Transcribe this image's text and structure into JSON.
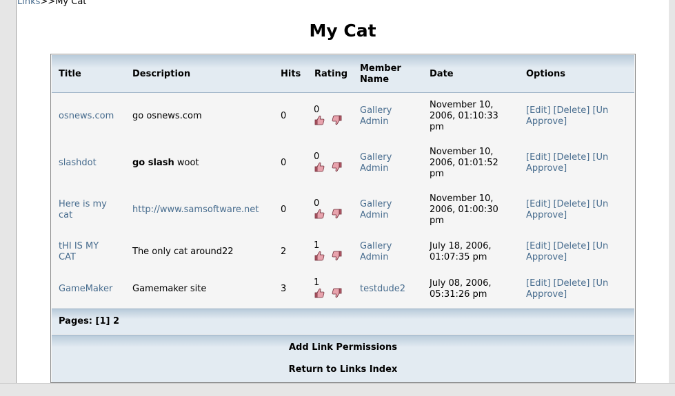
{
  "breadcrumb": {
    "link": "Links",
    "sep": ">>",
    "current": "My Cat"
  },
  "page_title": "My Cat",
  "columns": {
    "title": "Title",
    "description": "Description",
    "hits": "Hits",
    "rating": "Rating",
    "member_line1": "Member",
    "member_line2": "Name",
    "date": "Date",
    "options": "Options"
  },
  "rows": [
    {
      "title": "osnews.com",
      "desc": "go osnews.com",
      "hits": "0",
      "rating": "0",
      "member1": "Gallery",
      "member2": "Admin",
      "date1": "November 10,",
      "date2": "2006, 01:10:33",
      "date3": "pm",
      "opt1": "[Edit] [Delete] [Un",
      "opt2": "Approve]"
    },
    {
      "title": "slashdot",
      "desc_bold": "go slash",
      "desc_rest": " woot",
      "hits": "0",
      "rating": "0",
      "member1": "Gallery",
      "member2": "Admin",
      "date1": "November 10,",
      "date2": "2006, 01:01:52",
      "date3": "pm",
      "opt1": "[Edit] [Delete] [Un",
      "opt2": "Approve]"
    },
    {
      "title1": "Here is my",
      "title2": "cat",
      "desc_link": "http://www.samsoftware.net",
      "hits": "0",
      "rating": "0",
      "member1": "Gallery",
      "member2": "Admin",
      "date1": "November 10,",
      "date2": "2006, 01:00:30",
      "date3": "pm",
      "opt1": "[Edit] [Delete] [Un",
      "opt2": "Approve]"
    },
    {
      "title1": "tHI IS MY",
      "title2": "CAT",
      "desc": "The only cat around22",
      "hits": "2",
      "rating": "1",
      "member1": "Gallery",
      "member2": "Admin",
      "date1": "July 18, 2006,",
      "date2": "01:07:35 pm",
      "opt1": "[Edit] [Delete] [Un",
      "opt2": "Approve]"
    },
    {
      "title": "GameMaker",
      "desc": "Gamemaker site",
      "hits": "3",
      "rating": "1",
      "member1": "testdude2",
      "date1": "July 08, 2006,",
      "date2": "05:31:26 pm",
      "opt1": "[Edit] [Delete] [Un",
      "opt2": "Approve]"
    }
  ],
  "icons": {
    "up": "thumbs-up-icon",
    "down": "thumbs-down-icon",
    "color": "#c4606e"
  },
  "pagination": {
    "label": "Pages:",
    "current": "[1]",
    "next": "2"
  },
  "footer": {
    "add_permissions": "Add Link Permissions",
    "return": "Return to Links Index"
  },
  "colors": {
    "link": "#476c8e",
    "header_bg": "#e3ebf2",
    "row_bg": "#f5f5f5"
  }
}
